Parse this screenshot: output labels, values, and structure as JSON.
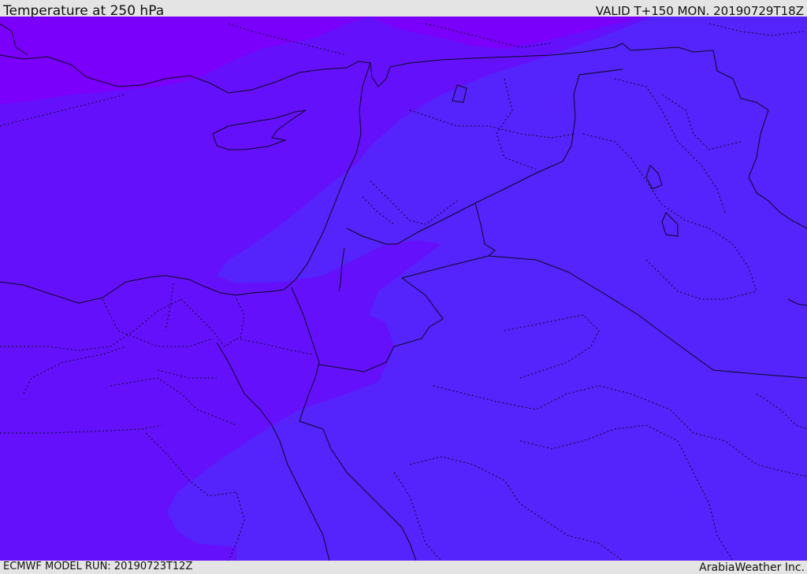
{
  "header": {
    "title": "Temperature at 250 hPa",
    "valid": "VALID T+150 MON. 20190729T18Z"
  },
  "footer": {
    "model_run": "ECMWF MODEL RUN: 20190723T12Z",
    "credit": "ArabiaWeather Inc."
  },
  "map": {
    "variable": "temperature",
    "level": "250 hPa",
    "colors": {
      "coldest_band": "#7b00fb",
      "cold_band": "#6510fb",
      "mid_band": "#5523fb",
      "coastline": "#0a0a1a",
      "border_dotted": "#0a0a1a"
    }
  }
}
